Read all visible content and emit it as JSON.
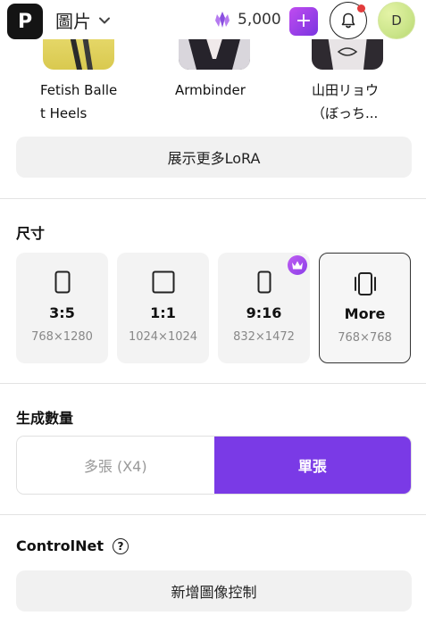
{
  "header": {
    "logo": "P",
    "nav_title": "圖片",
    "credits": "5,000",
    "plus": "+",
    "avatar_initial": "D"
  },
  "loras": [
    {
      "name_line1": "Fetish Balle",
      "name_line2": "t Heels"
    },
    {
      "name_line1": "Armbinder",
      "name_line2": ""
    },
    {
      "name_line1": "山田リョウ",
      "name_line2": "（ぼっち..."
    }
  ],
  "show_more_label": "展示更多LoRA",
  "size_section": {
    "title": "尺寸",
    "options": [
      {
        "ratio": "3:5",
        "dims": "768×1280",
        "selected": false
      },
      {
        "ratio": "1:1",
        "dims": "1024×1024",
        "selected": false
      },
      {
        "ratio": "9:16",
        "dims": "832×1472",
        "selected": false,
        "premium": true
      },
      {
        "ratio": "More",
        "dims": "768×768",
        "selected": true
      }
    ]
  },
  "quantity_section": {
    "title": "生成數量",
    "options": [
      "多張 (X4)",
      "單張"
    ],
    "selected": "單張"
  },
  "controlnet": {
    "title": "ControlNet",
    "help": "?",
    "add_label": "新增圖像控制"
  },
  "colors": {
    "accent": "#7a3ae6",
    "badge": "#e23b3b"
  }
}
